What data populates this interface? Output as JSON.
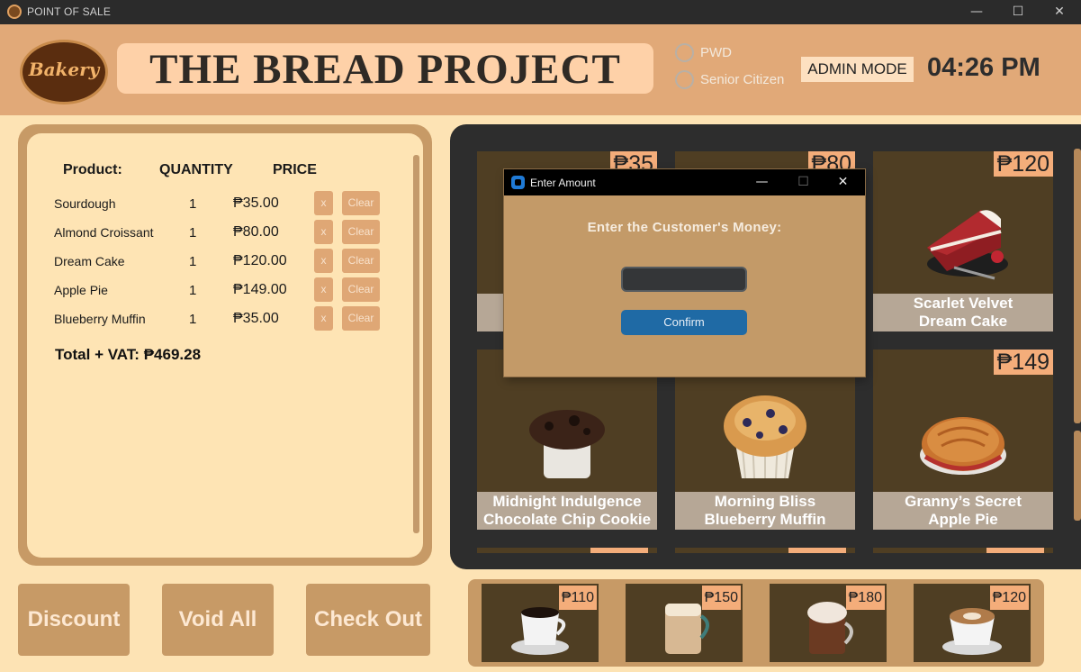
{
  "window": {
    "title": "POINT OF SALE",
    "controls": {
      "minimize": "—",
      "maximize": "☐",
      "close": "✕"
    }
  },
  "header": {
    "logo_text": "Bakery",
    "brand": "THE BREAD PROJECT",
    "options": [
      "PWD",
      "Senior Citizen"
    ],
    "mode_badge": "ADMIN MODE",
    "time": "04:26 PM"
  },
  "order": {
    "columns": {
      "product": "Product:",
      "quantity": "QUANTITY",
      "price": "PRICE"
    },
    "rows": [
      {
        "product": "Sourdough",
        "qty": "1",
        "price": "₱35.00",
        "remove": "x",
        "clear": "Clear"
      },
      {
        "product": "Almond Croissant",
        "qty": "1",
        "price": "₱80.00",
        "remove": "x",
        "clear": "Clear"
      },
      {
        "product": "Dream Cake",
        "qty": "1",
        "price": "₱120.00",
        "remove": "x",
        "clear": "Clear"
      },
      {
        "product": "Apple Pie",
        "qty": "1",
        "price": "₱149.00",
        "remove": "x",
        "clear": "Clear"
      },
      {
        "product": "Blueberry Muffin",
        "qty": "1",
        "price": "₱35.00",
        "remove": "x",
        "clear": "Clear"
      }
    ],
    "total": "Total + VAT: ₱469.28"
  },
  "actions": {
    "discount": "Discount",
    "void_all": "Void All",
    "check_out": "Check Out"
  },
  "products": [
    {
      "price": "₱35",
      "name_line1": "",
      "name_line2": "",
      "icon": "sourdough-bread"
    },
    {
      "price": "₱80",
      "name_line1": "",
      "name_line2": "",
      "icon": "almond-croissant"
    },
    {
      "price": "₱120",
      "name_line1": "Scarlet Velvet",
      "name_line2": "Dream Cake",
      "icon": "red-velvet-cake-slice"
    },
    {
      "price": "",
      "name_line1": "Midnight Indulgence",
      "name_line2": "Chocolate Chip Cookie",
      "icon": "chocolate-cookie-jar"
    },
    {
      "price": "",
      "name_line1": "Morning Bliss",
      "name_line2": "Blueberry Muffin",
      "icon": "blueberry-muffin"
    },
    {
      "price": "₱149",
      "name_line1": "Granny’s Secret",
      "name_line2": "Apple Pie",
      "icon": "apple-pie"
    }
  ],
  "drinks": [
    {
      "price": "₱110",
      "icon": "espresso-cup"
    },
    {
      "price": "₱150",
      "icon": "latte-glass"
    },
    {
      "price": "₱180",
      "icon": "mocha-mug"
    },
    {
      "price": "₱120",
      "icon": "cappuccino-cup"
    }
  ],
  "dialog": {
    "title": "Enter Amount",
    "prompt": "Enter the Customer's Money:",
    "input_value": "",
    "confirm": "Confirm"
  },
  "colors": {
    "header_bg": "#e1a978",
    "panel_tan": "#c79a66",
    "cream": "#fee4b4",
    "card_brown": "#4f3e23",
    "price_tag": "#f4ad7a",
    "confirm_blue": "#1f6aa5"
  }
}
